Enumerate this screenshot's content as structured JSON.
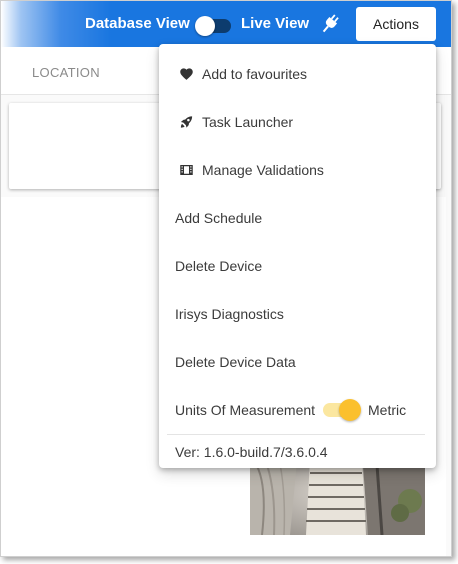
{
  "header": {
    "database_view_label": "Database View",
    "live_view_label": "Live View",
    "view_toggle_on": false,
    "actions_label": "Actions",
    "bar_color": "#1976e0"
  },
  "page": {
    "location_label": "LOCATION"
  },
  "menu": {
    "items": [
      {
        "label": "Add to favourites",
        "icon": "heart-icon"
      },
      {
        "label": "Task Launcher",
        "icon": "rocket-icon"
      },
      {
        "label": "Manage Validations",
        "icon": "film-icon"
      },
      {
        "label": "Add Schedule"
      },
      {
        "label": "Delete Device"
      },
      {
        "label": "Irisys Diagnostics"
      },
      {
        "label": "Delete Device Data"
      }
    ],
    "units": {
      "label": "Units Of Measurement",
      "value": "Metric",
      "on": true,
      "toggle_color": "#fbc02d"
    },
    "version": "Ver: 1.6.0-build.7/3.6.0.4"
  }
}
